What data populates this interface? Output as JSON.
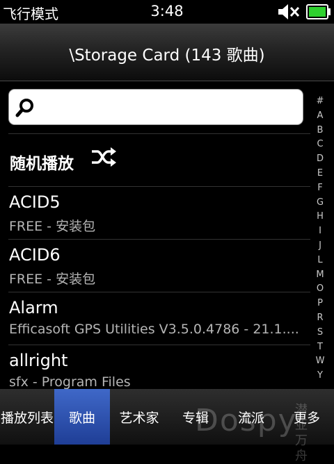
{
  "status": {
    "mode": "飞行模式",
    "time": "3:48",
    "battery_color": "#2fd12f",
    "icons": [
      "speaker-muted-icon",
      "battery-icon"
    ]
  },
  "header": {
    "title": "\\Storage Card (143 歌曲)"
  },
  "search": {
    "value": "",
    "placeholder": "",
    "icon": "search-icon"
  },
  "shuffle": {
    "label": "随机播放",
    "icon": "shuffle-icon"
  },
  "songs": [
    {
      "title": "ACID5",
      "subtitle": "FREE - 安装包"
    },
    {
      "title": "ACID6",
      "subtitle": "FREE - 安装包"
    },
    {
      "title": "Alarm",
      "subtitle": "Efficasoft GPS Utilities V3.5.0.4786 - 21.1...."
    },
    {
      "title": "allright",
      "subtitle": "sfx - Program Files"
    }
  ],
  "alpha_index": [
    "#",
    "A",
    "B",
    "C",
    "D",
    "E",
    "F",
    "G",
    "H",
    "I",
    "J",
    "L",
    "M",
    "O",
    "P",
    "R",
    "S",
    "T",
    "W",
    "Y"
  ],
  "tabs": [
    {
      "label": "播放列表",
      "active": false
    },
    {
      "label": "歌曲",
      "active": true
    },
    {
      "label": "艺术家",
      "active": false
    },
    {
      "label": "专辑",
      "active": false
    },
    {
      "label": "流派",
      "active": false
    },
    {
      "label": "更多",
      "active": false
    }
  ],
  "watermark": {
    "text": "Dospy",
    "sub1": "潜亚",
    "sub2": "万舟"
  },
  "accent": "#2d56b8"
}
